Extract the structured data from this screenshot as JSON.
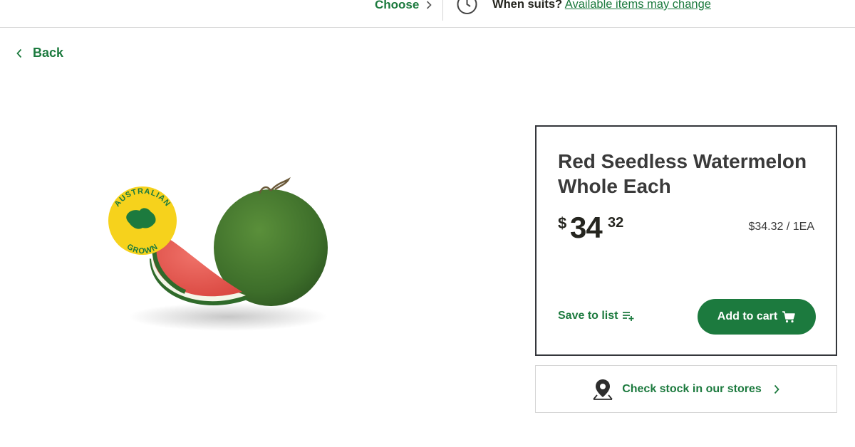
{
  "header": {
    "choose_label": "Choose",
    "delivery_question": "When suits?",
    "delivery_link": "Available items may change"
  },
  "nav": {
    "back_label": "Back"
  },
  "product": {
    "badge_top": "AUSTRALIAN",
    "badge_bottom": "GROWN",
    "title": "Red Seedless Watermelon Whole Each",
    "price_symbol": "$",
    "price_dollars": "34",
    "price_cents": "32",
    "unit_price": "$34.32 / 1EA",
    "save_label": "Save to list",
    "add_label": "Add to cart"
  },
  "stock": {
    "label": "Check stock in our stores"
  },
  "colors": {
    "brand_green": "#1c7a3e",
    "badge_yellow": "#f6d21c",
    "card_border": "#34363b"
  },
  "icons": [
    "chevron-right-icon",
    "clock-icon",
    "chevron-left-icon",
    "list-add-icon",
    "cart-icon",
    "location-pin-icon"
  ]
}
